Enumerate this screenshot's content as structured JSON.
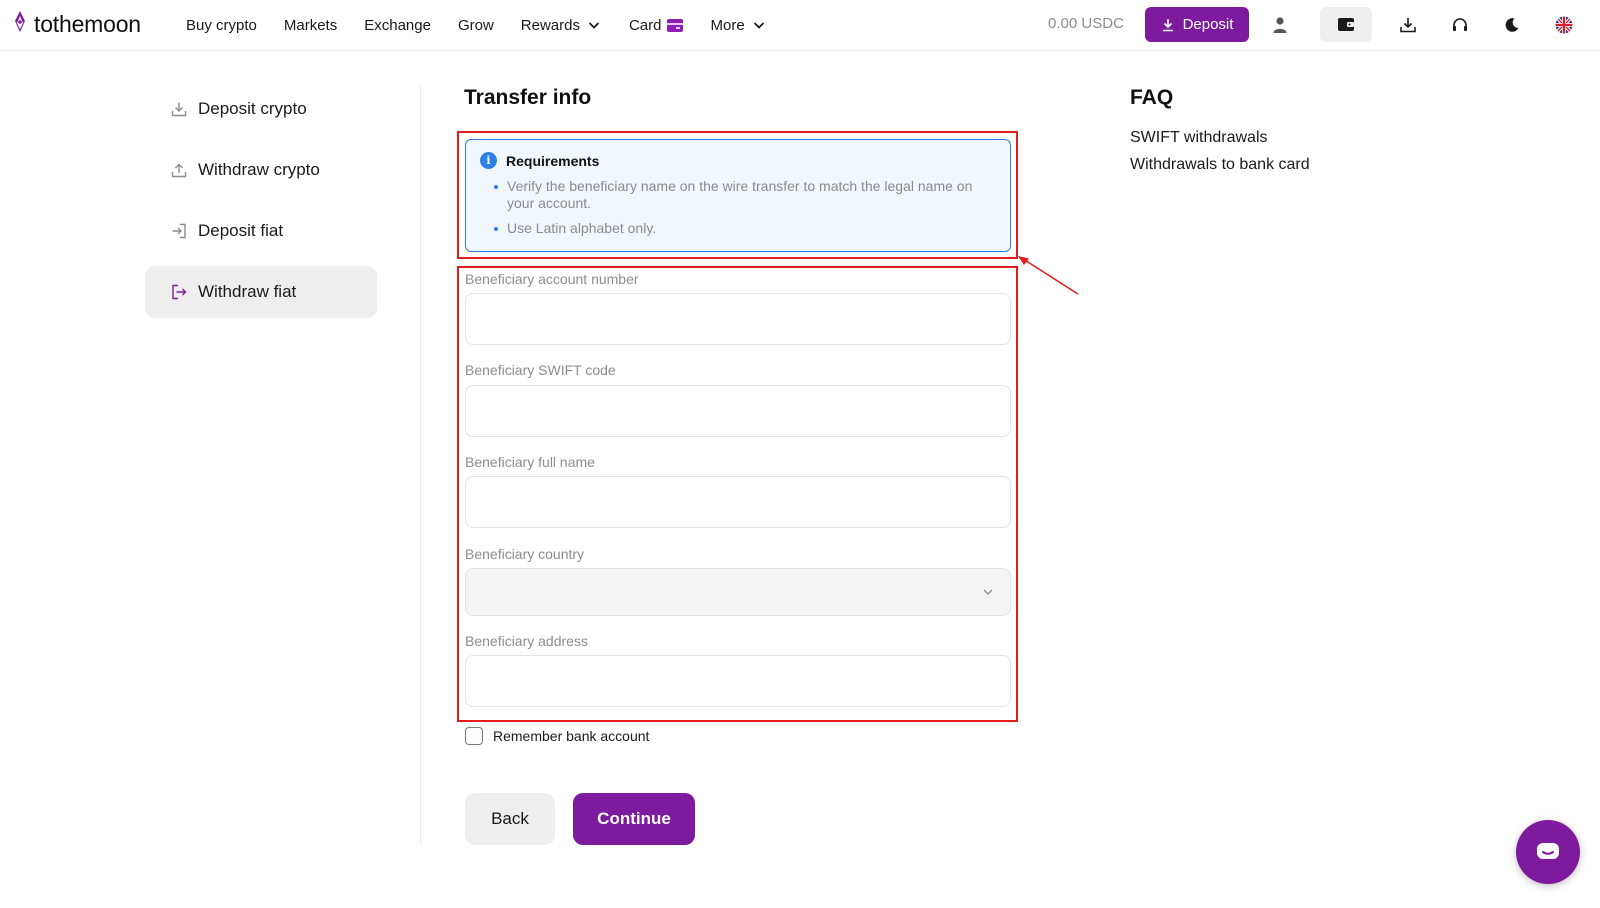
{
  "brand": {
    "name": "tothemoon",
    "accent": "#7d1a9e"
  },
  "nav": {
    "buy_crypto": "Buy crypto",
    "markets": "Markets",
    "exchange": "Exchange",
    "grow": "Grow",
    "rewards": "Rewards",
    "card": "Card",
    "more": "More"
  },
  "header": {
    "balance": "0.00 USDC",
    "deposit_label": "Deposit",
    "icons": [
      "user-icon",
      "wallet-icon",
      "download-icon",
      "headset-icon",
      "moon-icon",
      "uk-flag-icon"
    ]
  },
  "sidebar": {
    "items": [
      {
        "label": "Deposit crypto",
        "icon": "download-icon"
      },
      {
        "label": "Withdraw crypto",
        "icon": "upload-icon"
      },
      {
        "label": "Deposit fiat",
        "icon": "login-icon"
      },
      {
        "label": "Withdraw fiat",
        "icon": "logout-icon",
        "active": true
      }
    ]
  },
  "main": {
    "title": "Transfer info",
    "requirements": {
      "heading": "Requirements",
      "items": [
        "Verify the beneficiary name on the wire transfer to match the legal name on your account.",
        "Use Latin alphabet only."
      ]
    },
    "fields": {
      "account_number": {
        "label": "Beneficiary account number",
        "value": "",
        "placeholder": ""
      },
      "swift": {
        "label": "Beneficiary SWIFT code",
        "value": "",
        "placeholder": ""
      },
      "full_name": {
        "label": "Beneficiary full name",
        "value": "",
        "placeholder": ""
      },
      "country": {
        "label": "Beneficiary country",
        "value": ""
      },
      "address": {
        "label": "Beneficiary address",
        "value": "",
        "placeholder": ""
      }
    },
    "remember_label": "Remember bank account",
    "remember_checked": false,
    "back_label": "Back",
    "continue_label": "Continue"
  },
  "faq": {
    "title": "FAQ",
    "links": [
      "SWIFT withdrawals",
      "Withdrawals to bank card"
    ]
  },
  "annotation": {
    "color": "#e11d1d"
  }
}
